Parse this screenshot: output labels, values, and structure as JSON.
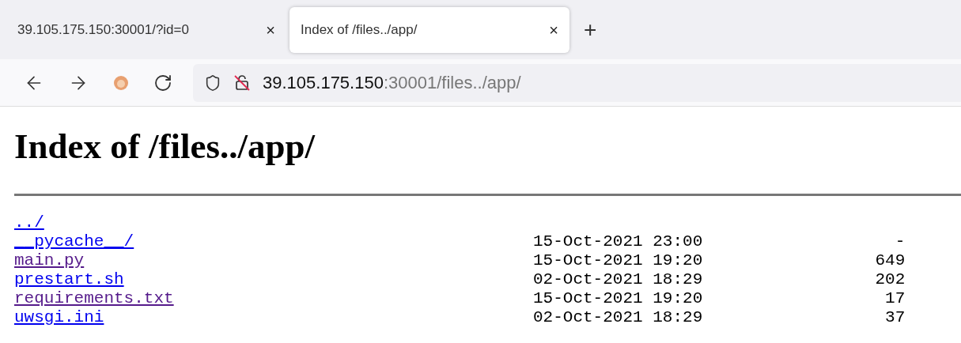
{
  "tabs": [
    {
      "title": "39.105.175.150:30001/?id=0",
      "close": "×",
      "selected": false
    },
    {
      "title": "Index of /files../app/",
      "close": "×",
      "selected": true
    }
  ],
  "new_tab": "+",
  "address_bar": {
    "host": "39.105.175.150",
    "rest": ":30001/files../app/"
  },
  "heading": "Index of /files../app/",
  "entries": [
    {
      "name": "../",
      "visited": false
    },
    {
      "name": "__pycache__/",
      "date": "15-Oct-2021 23:00",
      "size": "-",
      "visited": false
    },
    {
      "name": "main.py",
      "date": "15-Oct-2021 19:20",
      "size": "649",
      "visited": true
    },
    {
      "name": "prestart.sh",
      "date": "02-Oct-2021 18:29",
      "size": "202",
      "visited": false
    },
    {
      "name": "requirements.txt",
      "date": "15-Oct-2021 19:20",
      "size": "17",
      "visited": true
    },
    {
      "name": "uwsgi.ini",
      "date": "02-Oct-2021 18:29",
      "size": "37",
      "visited": false
    }
  ]
}
